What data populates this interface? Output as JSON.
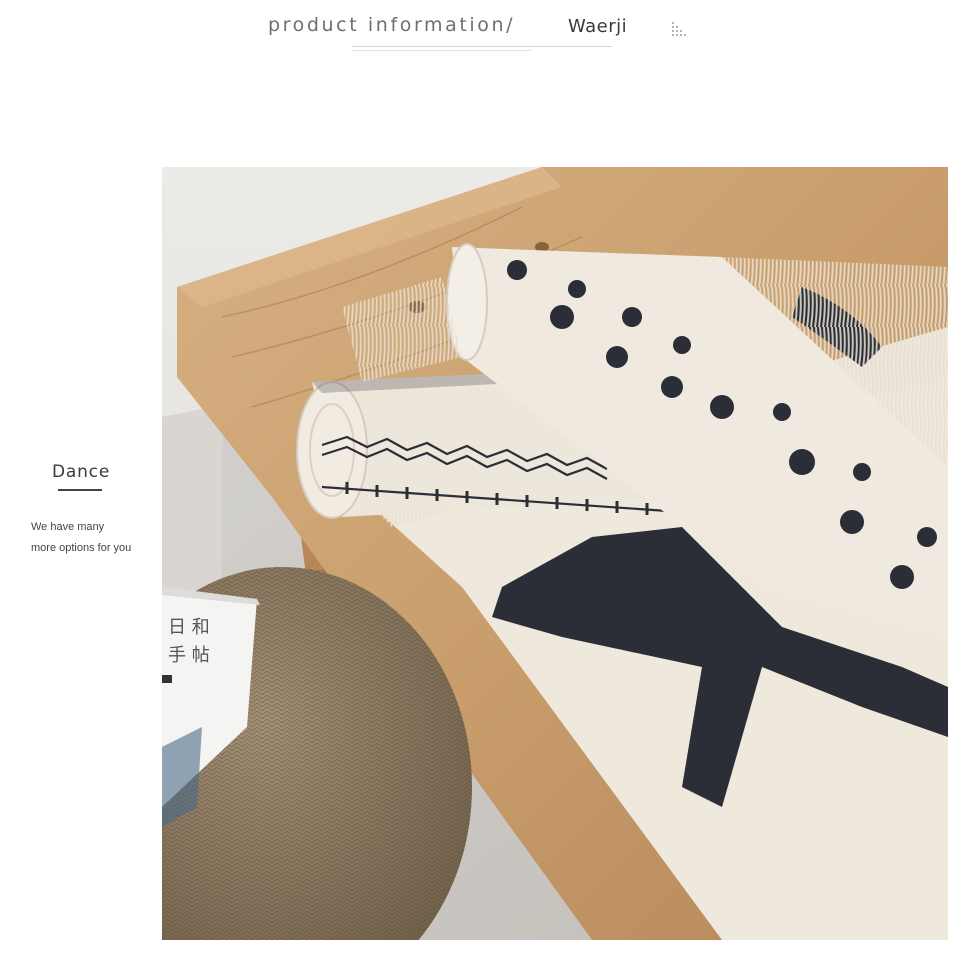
{
  "header": {
    "title": "product information/",
    "brand": "Waerji",
    "decor_icon": "dot-grid-icon"
  },
  "side": {
    "title": "Dance",
    "line1": "We have many",
    "line2": "more options for you"
  },
  "photo": {
    "book_text": [
      "日 和",
      "手 帖"
    ]
  },
  "colors": {
    "wood": "#c99e6c",
    "rug_cream": "#efe8dc",
    "rug_dark": "#2b2e36",
    "pouf": "#8d7a61",
    "wall": "#e9e6e1"
  }
}
